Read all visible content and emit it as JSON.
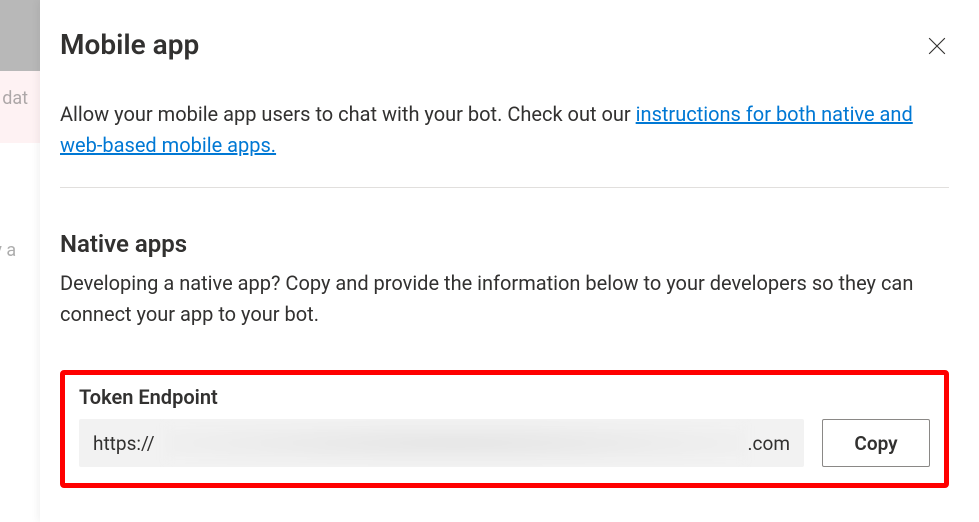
{
  "background": {
    "text1": "'s dat",
    "text2": "hey a"
  },
  "panel": {
    "title": "Mobile app",
    "close_aria": "Close",
    "description_pre": "Allow your mobile app users to chat with your bot. Check out our ",
    "description_link": "instructions for both native and web-based mobile apps.",
    "description_link_href": "#"
  },
  "native_section": {
    "title": "Native apps",
    "description": "Developing a native app? Copy and provide the information below to your developers so they can connect your app to your bot."
  },
  "token": {
    "label": "Token Endpoint",
    "value_prefix": "https://",
    "value_suffix": ".com",
    "copy_label": "Copy"
  }
}
